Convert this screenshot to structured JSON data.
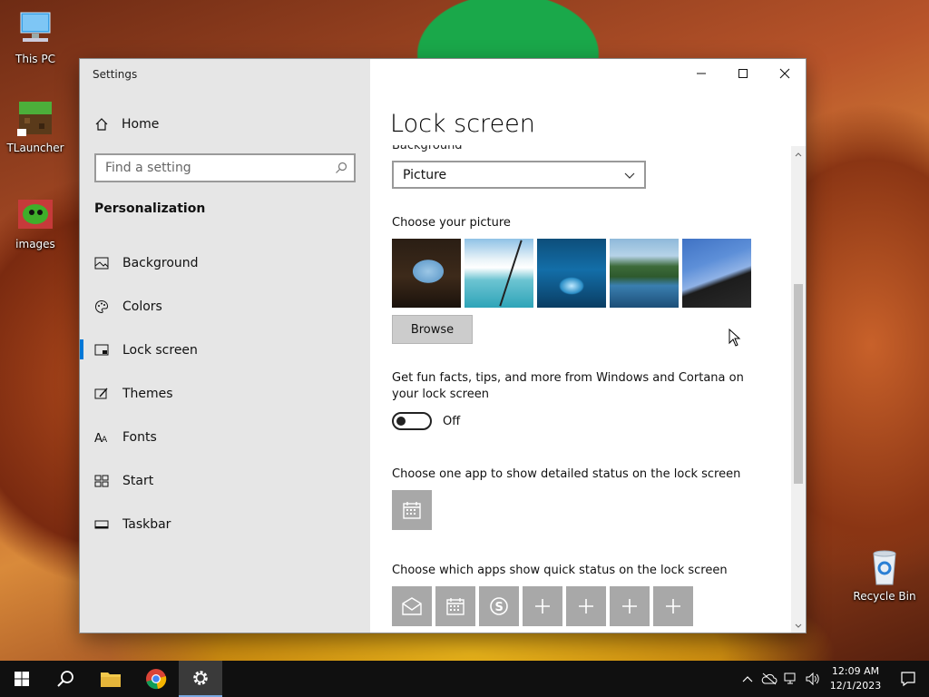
{
  "desktop": {
    "icons": [
      {
        "label": "This PC"
      },
      {
        "label": "TLauncher"
      },
      {
        "label": "images"
      },
      {
        "label": "Recycle Bin"
      }
    ]
  },
  "window": {
    "title": "Settings",
    "caption": {
      "minimize": "—",
      "maximize": "☐",
      "close": "✕"
    }
  },
  "sidebar": {
    "home": "Home",
    "search_placeholder": "Find a setting",
    "section": "Personalization",
    "items": [
      {
        "label": "Background",
        "icon": "picture-icon"
      },
      {
        "label": "Colors",
        "icon": "palette-icon"
      },
      {
        "label": "Lock screen",
        "icon": "lock-screen-icon",
        "active": true
      },
      {
        "label": "Themes",
        "icon": "themes-icon"
      },
      {
        "label": "Fonts",
        "icon": "fonts-icon"
      },
      {
        "label": "Start",
        "icon": "start-icon"
      },
      {
        "label": "Taskbar",
        "icon": "taskbar-icon"
      }
    ]
  },
  "content": {
    "title": "Lock screen",
    "background_label": "Background",
    "background_value": "Picture",
    "choose_picture_label": "Choose your picture",
    "browse_label": "Browse",
    "fun_facts_label": "Get fun facts, tips, and more from Windows and Cortana on your lock screen",
    "fun_facts_state": "Off",
    "detailed_status_label": "Choose one app to show detailed status on the lock screen",
    "quick_status_label": "Choose which apps show quick status on the lock screen",
    "quick_apps": [
      "mail-icon",
      "calendar-icon",
      "skype-icon",
      "plus-icon",
      "plus-icon",
      "plus-icon",
      "plus-icon"
    ]
  },
  "taskbar": {
    "time": "12:09 AM",
    "date": "12/1/2023"
  }
}
